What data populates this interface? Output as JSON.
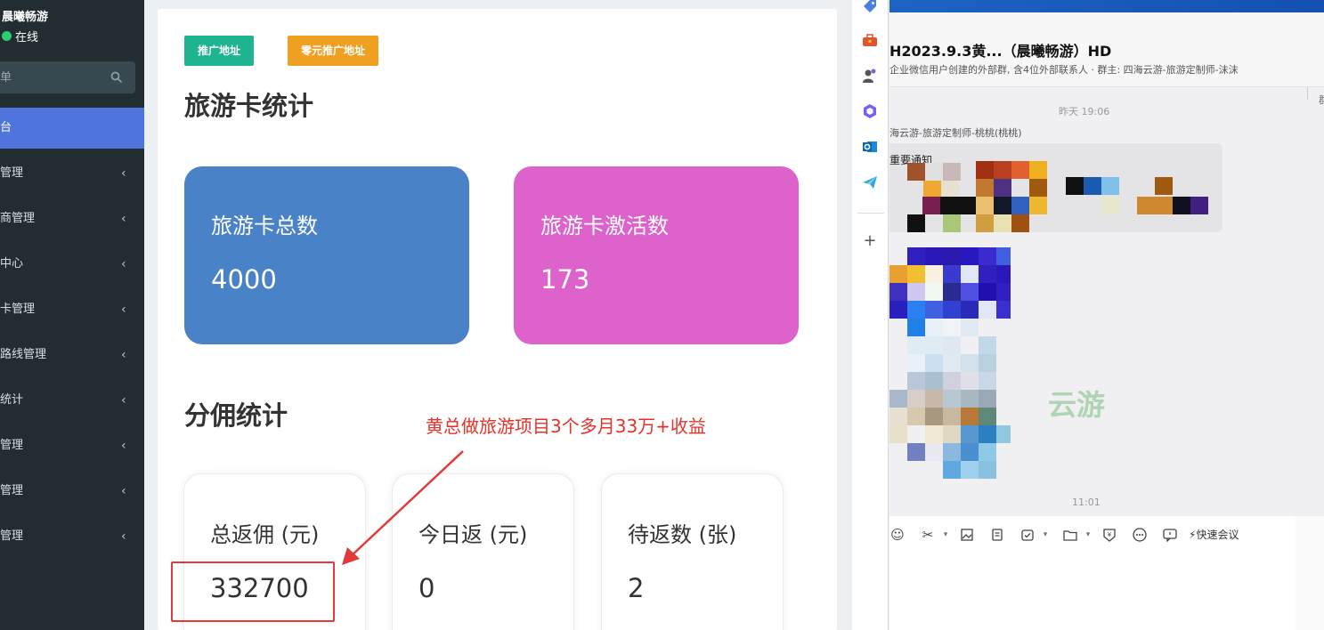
{
  "sidebar": {
    "user_name": "晨曦畅游",
    "status": "在线",
    "search_placeholder": "单",
    "menu": [
      {
        "label": "台",
        "active": true
      },
      {
        "label": "管理"
      },
      {
        "label": "商管理"
      },
      {
        "label": "中心"
      },
      {
        "label": "卡管理"
      },
      {
        "label": "路线管理"
      },
      {
        "label": "统计"
      },
      {
        "label": "管理"
      },
      {
        "label": "管理"
      },
      {
        "label": "管理"
      }
    ],
    "chevron": "‹"
  },
  "content": {
    "buttons": {
      "promo": "推广地址",
      "zero_promo": "零元推广地址"
    },
    "card_section_title": "旅游卡统计",
    "card_stats": [
      {
        "label": "旅游卡总数",
        "value": "4000",
        "color": "#4a82c8"
      },
      {
        "label": "旅游卡激活数",
        "value": "173",
        "color": "#dd62cc"
      }
    ],
    "commission_section_title": "分佣统计",
    "commission": [
      {
        "label": "总返佣 (元)",
        "value": "332700"
      },
      {
        "label": "今日返 (元)",
        "value": "0"
      },
      {
        "label": "待返数 (张)",
        "value": "2"
      }
    ],
    "annotation": "黄总做旅游项目3个多月33万+收益"
  },
  "chat": {
    "title": "H2023.9.3黄...（晨曦畅游）HD",
    "subtitle": "企业微信用户创建的外部群, 含4位外部联系人 · 群主: 四海云游-旅游定制师-沫沫",
    "time1": "昨天 19:06",
    "sender": "海云游-旅游定制师-桃桃(桃桃)",
    "message_start": "重要通知",
    "watermark": "云游",
    "time2": "11:01",
    "quick_meeting": "快速会议",
    "edge_char": "群"
  },
  "colors": {
    "sidebar_bg": "#222d32",
    "active_menu": "#4f74de",
    "green_button": "#1eb48f",
    "orange_button": "#f0a020",
    "annotation_red": "#e53228"
  }
}
